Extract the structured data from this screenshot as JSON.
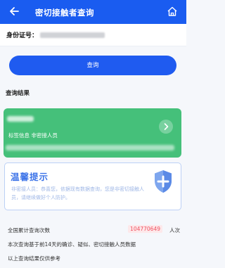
{
  "header": {
    "title": "密切接触者查询",
    "back_icon": "back-arrow-icon",
    "home_icon": "home-icon",
    "color": "#1a5cf0"
  },
  "id_field": {
    "label": "身份证号："
  },
  "query_button": {
    "label": "查询",
    "color": "#1f5bf0"
  },
  "results": {
    "title": "查询结果",
    "card": {
      "tag_text": "标签信息 非密接人员",
      "color": "#45c07a",
      "arrow_icon": "chevron-right-icon"
    }
  },
  "tip": {
    "title": "温馨提示",
    "text": "非密接人员：恭喜您，依据现有数据查询，您是非密切接触人员，请继续做好个人防护。",
    "icon": "shield-plus-icon"
  },
  "stats": {
    "label": "全国累计查询次数",
    "value": "104770649",
    "unit": "人次",
    "note_1": "本次查询基于前14天的确诊、疑似、密切接触人员数据",
    "note_2": "以上查询结果仅供参考"
  }
}
